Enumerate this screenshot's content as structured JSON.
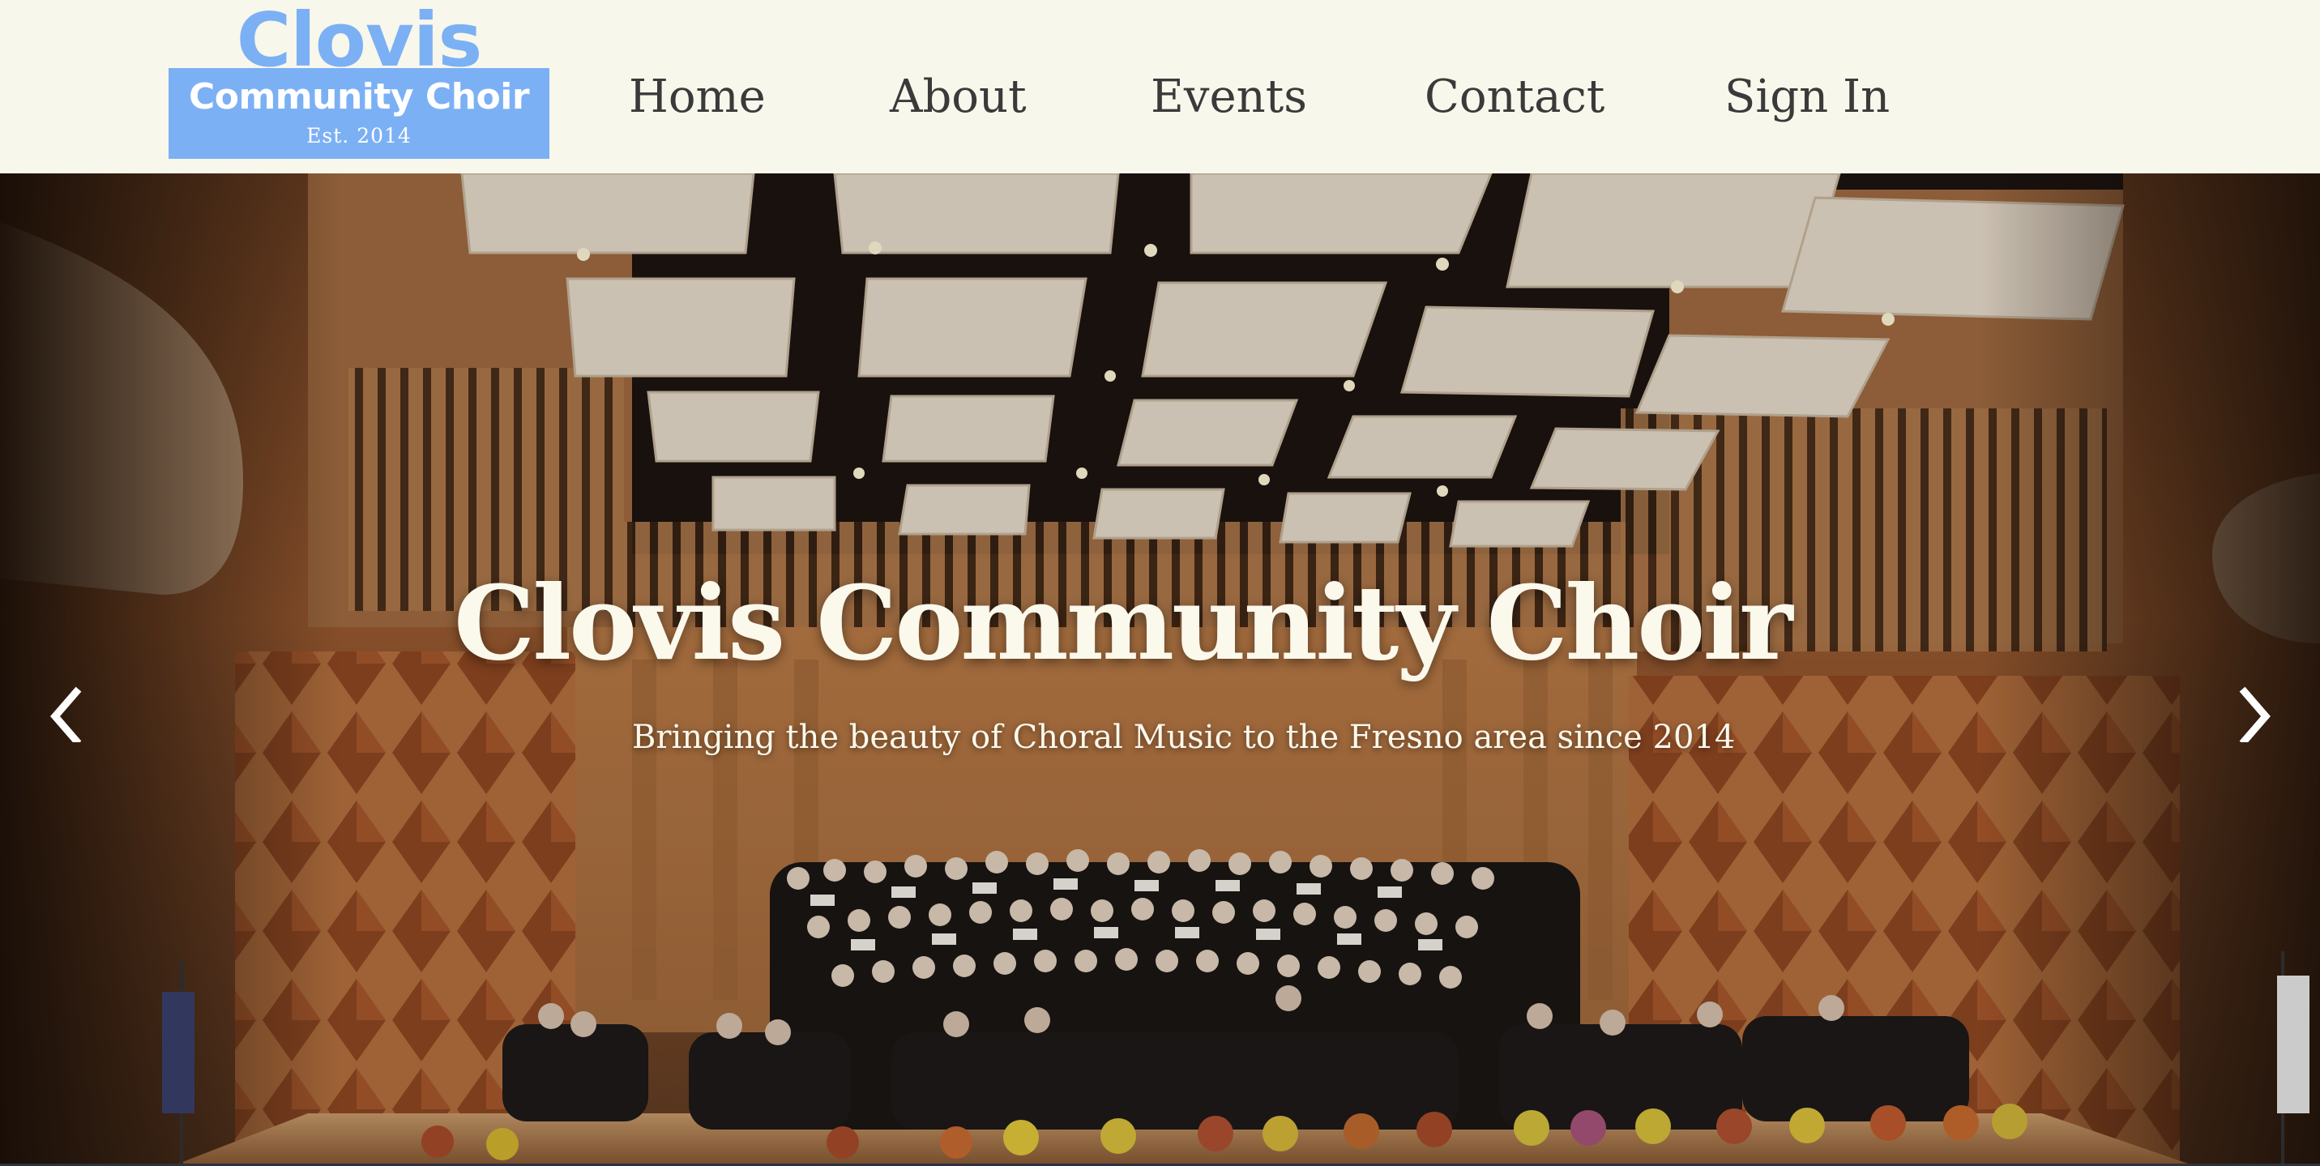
{
  "logo": {
    "top_text": "Clovis",
    "main_text": "Community Choir",
    "est_text": "Est. 2014"
  },
  "nav": {
    "items": [
      {
        "label": "Home"
      },
      {
        "label": "About"
      },
      {
        "label": "Events"
      },
      {
        "label": "Contact"
      },
      {
        "label": "Sign In"
      }
    ]
  },
  "hero": {
    "title": "Clovis Community Choir",
    "subtitle": "Bringing the beauty of Choral Music to the Fresno area since 2014",
    "photo": "concert-hall-choir-photo",
    "prev_icon": "chevron-left-icon",
    "next_icon": "chevron-right-icon"
  },
  "colors": {
    "header_bg": "#f8f7ec",
    "logo_blue": "#7cb0f4",
    "nav_text": "#3a3a3a",
    "hero_text": "#fbf8ec"
  }
}
